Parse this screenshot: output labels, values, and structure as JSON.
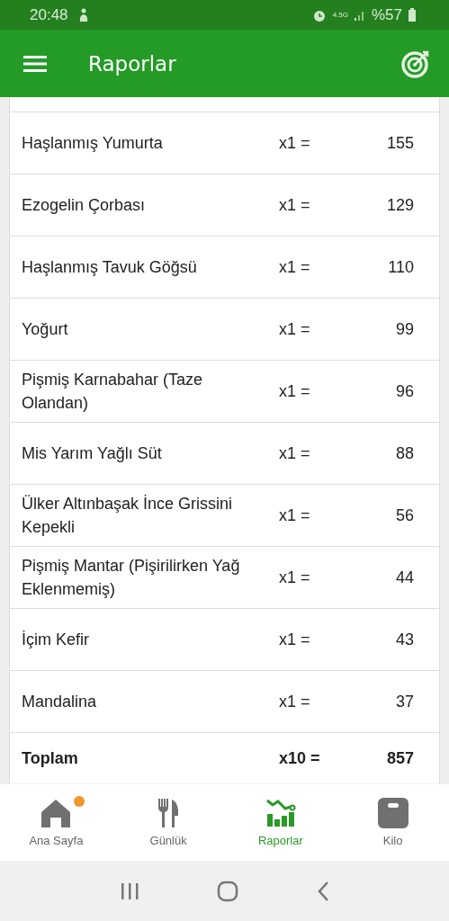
{
  "status_bar": {
    "time": "20:48",
    "network": "4.5G",
    "battery": "%57"
  },
  "app_bar": {
    "title": "Raporlar"
  },
  "table": {
    "rows": [
      {
        "name": "Haşlanmış Yumurta",
        "count": "x1 =",
        "value": "155"
      },
      {
        "name": "Ezogelin Çorbası",
        "count": "x1 =",
        "value": "129"
      },
      {
        "name": "Haşlanmış Tavuk Göğsü",
        "count": "x1 =",
        "value": "110"
      },
      {
        "name": "Yoğurt",
        "count": "x1 =",
        "value": "99"
      },
      {
        "name": "Pişmiş Karnabahar (Taze Olandan)",
        "count": "x1 =",
        "value": "96"
      },
      {
        "name": "Mis Yarım Yağlı Süt",
        "count": "x1 =",
        "value": "88"
      },
      {
        "name": "Ülker Altınbaşak İnce Grissini Kepekli",
        "count": "x1 =",
        "value": "56"
      },
      {
        "name": "Pişmiş Mantar (Pişirilirken Yağ Eklenmemiş)",
        "count": "x1 =",
        "value": "44"
      },
      {
        "name": "İçim Kefir",
        "count": "x1 =",
        "value": "43"
      },
      {
        "name": "Mandalina",
        "count": "x1 =",
        "value": "37"
      }
    ],
    "total": {
      "name": "Toplam",
      "count": "x10 =",
      "value": "857"
    }
  },
  "bottom_nav": [
    {
      "kind": "home",
      "label": "Ana Sayfa",
      "selected": false,
      "badge": true
    },
    {
      "kind": "diary",
      "label": "Günlük",
      "selected": false,
      "badge": false
    },
    {
      "kind": "reports",
      "label": "Raporlar",
      "selected": true,
      "badge": false
    },
    {
      "kind": "weight",
      "label": "Kilo",
      "selected": false,
      "badge": false
    }
  ]
}
